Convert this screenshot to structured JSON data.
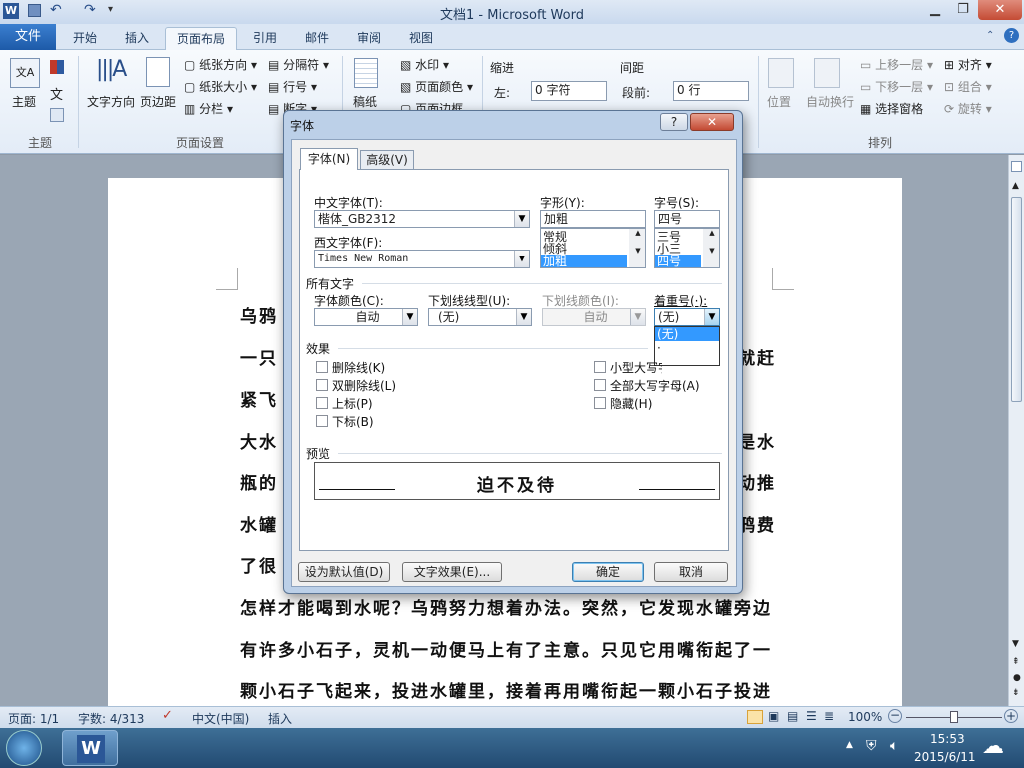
{
  "window": {
    "title": "文档1 - Microsoft Word"
  },
  "tabs": {
    "file": "文件",
    "items": [
      "开始",
      "插入",
      "页面布局",
      "引用",
      "邮件",
      "审阅",
      "视图"
    ],
    "active": "页面布局"
  },
  "ribbon": {
    "theme": {
      "label": "主题",
      "group": "主题"
    },
    "page_setup": {
      "text_dir": "文字方向",
      "margins": "页边距",
      "orientation": "纸张方向",
      "size": "纸张大小",
      "columns": "分栏",
      "breaks": "分隔符",
      "line_numbers": "行号",
      "hyphenation": "断字",
      "group": "页面设置"
    },
    "manuscript": {
      "label": "稿纸"
    },
    "background": {
      "watermark": "水印",
      "page_color": "页面颜色",
      "page_border": "页面边框"
    },
    "paragraph": {
      "indent": "缩进",
      "indent_left": "左:",
      "indent_left_val": "0 字符",
      "spacing": "间距",
      "spacing_before": "段前:",
      "spacing_before_val": "0 行"
    },
    "arrange": {
      "position": "位置",
      "wrap": "自动换行",
      "bring_forward": "上移一层",
      "send_backward": "下移一层",
      "selection_pane": "选择窗格",
      "align": "对齐",
      "group_btn": "组合",
      "rotate": "旋转",
      "group": "排列"
    }
  },
  "document": {
    "lines": [
      "乌鸦",
      "一只",
      "紧飞",
      "大水",
      "瓶的",
      "水罐",
      "了很",
      "怎样才能喝到水呢？乌鸦努力想着办法。突然，它发现水罐旁边",
      "有许多小石子，灵机一动便马上有了主意。只见它用嘴衔起了一",
      "颗小石子飞起来，投进水罐里，接着再用嘴衔起一颗小石子投进"
    ],
    "right_frags": [
      "就赶",
      "是水",
      "动推",
      "鸦费"
    ]
  },
  "dialog": {
    "title": "字体",
    "help": "?",
    "close": "✕",
    "tab_font": "字体(N)",
    "tab_advanced": "高级(V)",
    "cn_font_label": "中文字体(T):",
    "cn_font_value": "楷体_GB2312",
    "west_font_label": "西文字体(F):",
    "west_font_value": "Times New Roman",
    "style_label": "字形(Y):",
    "style_value": "加粗",
    "style_options": [
      "常规",
      "倾斜",
      "加粗"
    ],
    "size_label": "字号(S):",
    "size_value": "四号",
    "size_options": [
      "三号",
      "小三",
      "四号"
    ],
    "all_text": "所有文字",
    "color_label": "字体颜色(C):",
    "color_value": "自动",
    "underline_label": "下划线线型(U):",
    "underline_value": "(无)",
    "ul_color_label": "下划线颜色(I):",
    "ul_color_value": "自动",
    "emphasis_label": "着重号(·):",
    "emphasis_value": "(无)",
    "emphasis_options": [
      "(无)",
      "·"
    ],
    "effects": "效果",
    "strike": "删除线(K)",
    "dstrike": "双删除线(L)",
    "superscript": "上标(P)",
    "subscript": "下标(B)",
    "small_caps": "小型大写字母(M)",
    "all_caps": "全部大写字母(A)",
    "hidden": "隐藏(H)",
    "preview": "预览",
    "preview_text": "迫不及待",
    "set_default": "设为默认值(D)",
    "text_effects": "文字效果(E)...",
    "ok": "确定",
    "cancel": "取消"
  },
  "status": {
    "page": "页面: 1/1",
    "words": "字数: 4/313",
    "lang": "中文(中国)",
    "mode": "插入",
    "zoom": "100%"
  },
  "taskbar": {
    "time": "15:53",
    "date": "2015/6/11"
  }
}
